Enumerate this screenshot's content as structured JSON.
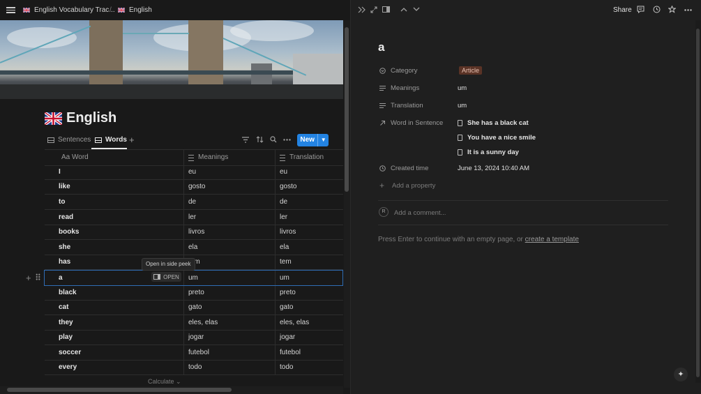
{
  "breadcrumb": {
    "parent": "English Vocabulary Trac...",
    "separator": "/",
    "current": "English"
  },
  "page": {
    "title": "English"
  },
  "views": {
    "tab1": "Sentences",
    "tab2": "Words",
    "new_label": "New"
  },
  "table": {
    "headers": {
      "word": "Aa Word",
      "meanings": "Meanings",
      "translation": "Translation"
    },
    "rows": [
      {
        "word": "I",
        "meanings": "eu",
        "translation": "eu"
      },
      {
        "word": "like",
        "meanings": "gosto",
        "translation": "gosto"
      },
      {
        "word": "to",
        "meanings": "de",
        "translation": "de"
      },
      {
        "word": "read",
        "meanings": "ler",
        "translation": "ler"
      },
      {
        "word": "books",
        "meanings": "livros",
        "translation": "livros"
      },
      {
        "word": "she",
        "meanings": "ela",
        "translation": "ela"
      },
      {
        "word": "has",
        "meanings": "tem",
        "translation": "tem"
      },
      {
        "word": "a",
        "meanings": "um",
        "translation": "um"
      },
      {
        "word": "black",
        "meanings": "preto",
        "translation": "preto"
      },
      {
        "word": "cat",
        "meanings": "gato",
        "translation": "gato"
      },
      {
        "word": "they",
        "meanings": "eles, elas",
        "translation": "eles, elas"
      },
      {
        "word": "play",
        "meanings": "jogar",
        "translation": "jogar"
      },
      {
        "word": "soccer",
        "meanings": "futebol",
        "translation": "futebol"
      },
      {
        "word": "every",
        "meanings": "todo",
        "translation": "todo"
      }
    ],
    "tooltip": "Open in side peek",
    "open_label": "OPEN",
    "calculate_label": "Calculate"
  },
  "side_peek": {
    "share_label": "Share",
    "title": "a",
    "properties": {
      "category_label": "Category",
      "category_value": "Article",
      "meanings_label": "Meanings",
      "meanings_value": "um",
      "translation_label": "Translation",
      "translation_value": "um",
      "sentence_label": "Word in Sentence",
      "sentences": [
        "She has a black cat",
        "You have a nice smile",
        "It is a sunny day"
      ],
      "created_label": "Created time",
      "created_value": "June 13, 2024 10:40 AM",
      "add_property": "Add a property"
    },
    "avatar_initial": "R",
    "comment_placeholder": "Add a comment...",
    "hint_text": "Press Enter to continue with an empty page, or ",
    "hint_link": "create a template"
  },
  "colors": {
    "accent": "#2383e2",
    "background": "#191919",
    "panel": "#1f1f1f",
    "tag_bg": "#5a3326",
    "tag_text": "#e8c2b3"
  }
}
